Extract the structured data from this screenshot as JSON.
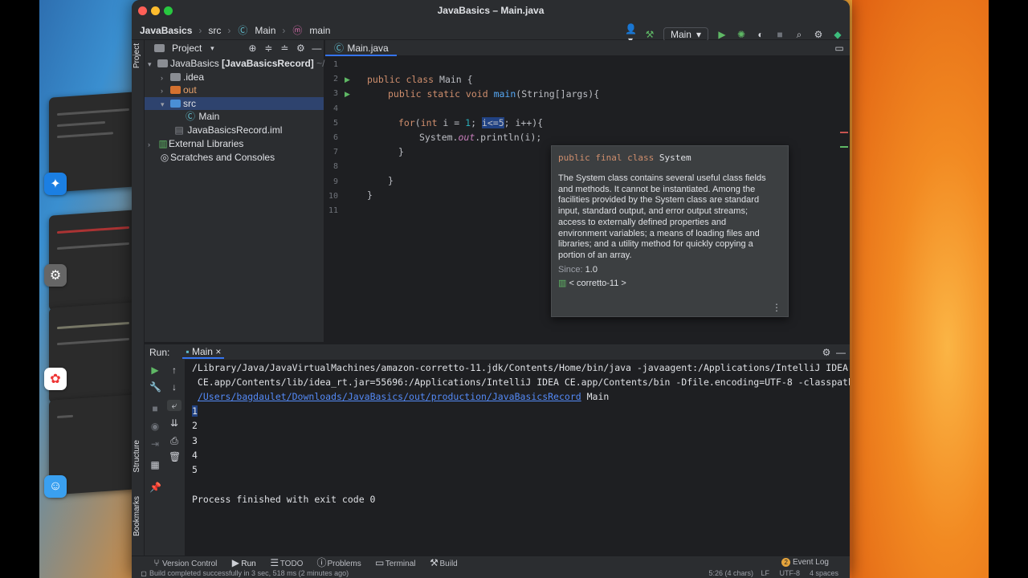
{
  "window": {
    "title": "JavaBasics – Main.java"
  },
  "breadcrumb": {
    "project": "JavaBasics",
    "folder": "src",
    "class": "Main",
    "method": "main"
  },
  "toolbar": {
    "run_config": "Main"
  },
  "left_stripe": {
    "project": "Project",
    "structure": "Structure",
    "bookmarks": "Bookmarks"
  },
  "project_panel": {
    "title": "Project",
    "root": "JavaBasics",
    "root_module": "[JavaBasicsRecord]",
    "root_path": "~/",
    "items": [
      {
        "label": ".idea"
      },
      {
        "label": "out"
      },
      {
        "label": "src"
      },
      {
        "label": "Main"
      },
      {
        "label": "JavaBasicsRecord.iml"
      },
      {
        "label": "External Libraries"
      },
      {
        "label": "Scratches and Consoles"
      }
    ]
  },
  "editor": {
    "tab": "Main.java",
    "line_numbers": [
      "1",
      "2",
      "3",
      "4",
      "5",
      "6",
      "7",
      "8",
      "9",
      "10",
      "11"
    ],
    "code": {
      "l2_kw": "public class",
      "l2_rest": " Main {",
      "l3_kw": "public static void",
      "l3_fn": "main",
      "l3_rest": "(String[]args){",
      "l5_kw": "for",
      "l5_a": "(",
      "l5_kw2": "int",
      "l5_b": " i = ",
      "l5_num": "1",
      "l5_c": "; ",
      "l5_hl": "i<=5",
      "l5_d": "; i++){",
      "l6_a": "System.",
      "l6_fld": "out",
      "l6_b": ".println(i);",
      "l7": "}",
      "l9": "}",
      "l10": "}"
    }
  },
  "doc_popup": {
    "signature_kw": "public final class",
    "signature_name": "System",
    "description": "The System class contains several useful class fields and methods. It cannot be instantiated. Among the facilities provided by the System class are standard input, standard output, and error output streams; access to externally defined properties and environment variables; a means of loading files and libraries; and a utility method for quickly copying a portion of an array.",
    "since_label": "Since:",
    "since_value": "1.0",
    "library": "< corretto-11 >"
  },
  "run_panel": {
    "label": "Run:",
    "tab": "Main",
    "lines": {
      "cmd1": "/Library/Java/JavaVirtualMachines/amazon-corretto-11.jdk/Contents/Home/bin/java -javaagent:/Applications/IntelliJ IDEA",
      "cmd2": " CE.app/Contents/lib/idea_rt.jar=55696:/Applications/IntelliJ IDEA CE.app/Contents/bin -Dfile.encoding=UTF-8 -classpath",
      "cmd3_link": "/Users/bagdaulet/Downloads/JavaBasics/out/production/JavaBasicsRecord",
      "cmd3_rest": " Main",
      "out1": "1",
      "out2": "2",
      "out3": "3",
      "out4": "4",
      "out5": "5",
      "exit": "Process finished with exit code 0"
    }
  },
  "tool_strip": {
    "version_control": "Version Control",
    "run": "Run",
    "todo": "TODO",
    "problems": "Problems",
    "terminal": "Terminal",
    "build": "Build",
    "event_log": "Event Log",
    "event_count": "2"
  },
  "status_bar": {
    "message": "Build completed successfully in 3 sec, 518 ms (2 minutes ago)",
    "position": "5:26 (4 chars)",
    "line_sep": "LF",
    "encoding": "UTF-8",
    "indent": "4 spaces"
  },
  "colors": {
    "accent": "#3574f0",
    "run_green": "#5fb865",
    "keyword": "#cf8e6d",
    "function": "#56a8f5",
    "number": "#2aacb8"
  },
  "icons": [
    "folder-icon",
    "class-icon",
    "method-icon",
    "run-icon",
    "debug-icon",
    "stop-icon",
    "search-icon",
    "gear-icon",
    "hammer-icon",
    "user-icon",
    "minimize-icon"
  ]
}
